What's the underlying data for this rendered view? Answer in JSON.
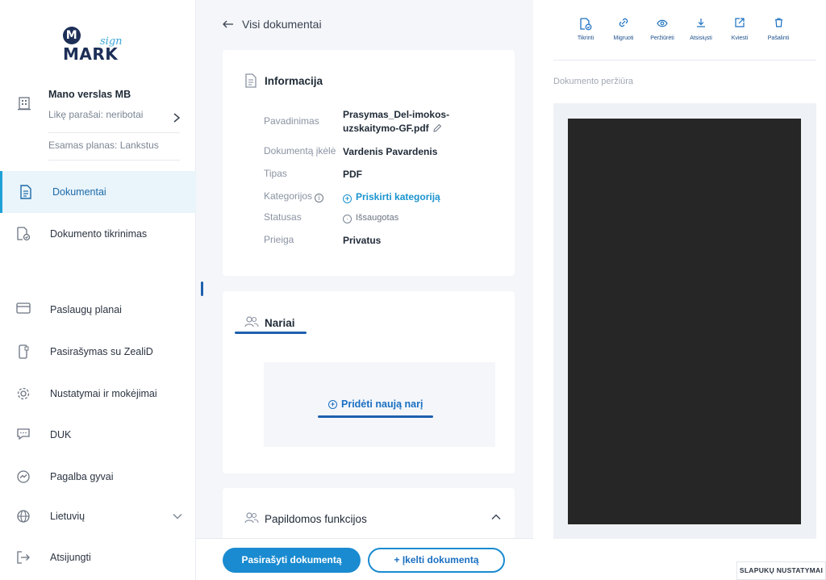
{
  "logo": {
    "mark": "MARK",
    "sign": "sign"
  },
  "account": {
    "name": "Mano verslas MB",
    "signatures": "Likę parašai: neribotai",
    "plan": "Esamas planas: Lankstus"
  },
  "nav": {
    "documents": "Dokumentai",
    "verification": "Dokumento tikrinimas",
    "plans": "Paslaugų planai",
    "zealid": "Pasirašymas su ZealiD",
    "settings": "Nustatymai ir mokėjimai",
    "faq": "DUK",
    "live_help": "Pagalba gyvai",
    "language": "Lietuvių",
    "logout": "Atsijungti"
  },
  "back": {
    "label": "Visi dokumentai"
  },
  "info_card": {
    "title": "Informacija",
    "rows": {
      "name_label": "Pavadinimas",
      "name_value_1": "Prasymas_Del-imokos-",
      "name_value_2": "uzskaitymo-GF.pdf",
      "uploader_label": "Dokumentą įkėlė",
      "uploader_value": "Vardenis Pavardenis",
      "type_label": "Tipas",
      "type_value": "PDF",
      "categories_label": "Kategorijos",
      "categories_value": "Priskirti kategoriją",
      "status_label": "Statusas",
      "status_value": "Išsaugotas",
      "access_label": "Prieiga",
      "access_value": "Privatus"
    }
  },
  "members_card": {
    "title": "Nariai",
    "add_label": "Pridėti naują narį"
  },
  "extra_card": {
    "title": "Papildomos funkcijos"
  },
  "actions": {
    "sign": "Pasirašyti dokumentą",
    "upload": "+ Įkelti dokumentą"
  },
  "toolbar": {
    "check": "Tikrinti",
    "migrate": "Migruoti",
    "view": "Peržiūrėti",
    "download": "Atsisiųsti",
    "invite": "Kviesti",
    "delete": "Pašalinti"
  },
  "preview": {
    "title": "Dokumento peržiūra"
  },
  "cookie": {
    "label": "SLAPUKŲ NUSTATYMAI"
  },
  "colors": {
    "accent": "#1a8bd0",
    "brand_dark": "#1d2f57",
    "active_bg": "#e9f4fb"
  }
}
